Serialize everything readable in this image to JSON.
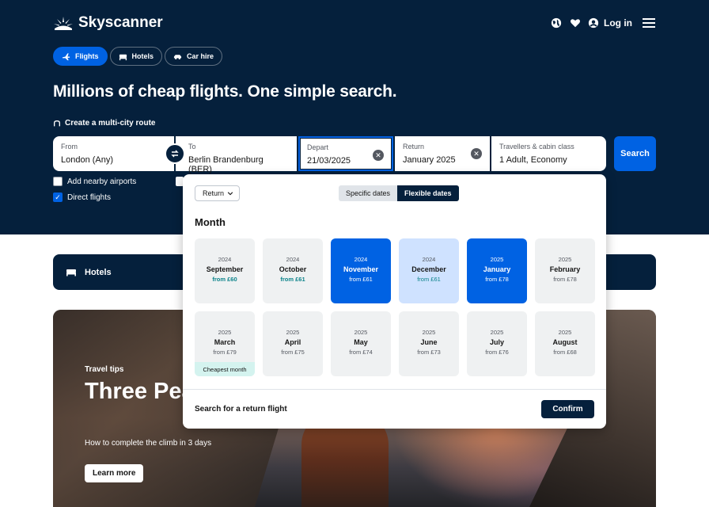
{
  "header": {
    "brand": "Skyscanner",
    "login_label": "Log in"
  },
  "nav_tabs": [
    {
      "label": "Flights",
      "icon": "plane-icon",
      "active": true
    },
    {
      "label": "Hotels",
      "icon": "bed-icon",
      "active": false
    },
    {
      "label": "Car hire",
      "icon": "car-icon",
      "active": false
    }
  ],
  "headline": "Millions of cheap flights. One simple search.",
  "multicity_label": "Create a multi-city route",
  "search": {
    "from": {
      "label": "From",
      "value": "London (Any)"
    },
    "to": {
      "label": "To",
      "value": "Berlin Brandenburg (BER)"
    },
    "depart": {
      "label": "Depart",
      "value": "21/03/2025"
    },
    "return": {
      "label": "Return",
      "value": "January 2025"
    },
    "travellers": {
      "label": "Travellers & cabin class",
      "value": "1 Adult, Economy"
    },
    "button_label": "Search"
  },
  "options": {
    "nearby": {
      "label": "Add nearby airports",
      "checked": false
    },
    "direct": {
      "label": "Direct flights",
      "checked": true
    }
  },
  "hotels_bar": {
    "label": "Hotels"
  },
  "promo": {
    "kicker": "Travel tips",
    "title": "Three Peaks Challenge",
    "subtitle": "How to complete the climb in 3 days",
    "button_label": "Learn more"
  },
  "date_picker": {
    "trip_type": "Return",
    "date_modes": [
      "Specific dates",
      "Flexible dates"
    ],
    "active_mode": "Flexible dates",
    "heading": "Month",
    "months": [
      {
        "year": "2024",
        "month": "September",
        "price": "from £60",
        "state": "cheap"
      },
      {
        "year": "2024",
        "month": "October",
        "price": "from £61",
        "state": "cheap"
      },
      {
        "year": "2024",
        "month": "November",
        "price": "from £61",
        "state": "selected"
      },
      {
        "year": "2024",
        "month": "December",
        "price": "from £61",
        "state": "in-range"
      },
      {
        "year": "2025",
        "month": "January",
        "price": "from £78",
        "state": "selected"
      },
      {
        "year": "2025",
        "month": "February",
        "price": "from £78",
        "state": "normal"
      },
      {
        "year": "2025",
        "month": "March",
        "price": "from £79",
        "state": "normal",
        "badge": "Cheapest month"
      },
      {
        "year": "2025",
        "month": "April",
        "price": "from £75",
        "state": "normal"
      },
      {
        "year": "2025",
        "month": "May",
        "price": "from £74",
        "state": "normal"
      },
      {
        "year": "2025",
        "month": "June",
        "price": "from £73",
        "state": "normal"
      },
      {
        "year": "2025",
        "month": "July",
        "price": "from £76",
        "state": "normal"
      },
      {
        "year": "2025",
        "month": "August",
        "price": "from £68",
        "state": "normal"
      }
    ],
    "footer_text": "Search for a return flight",
    "confirm_label": "Confirm"
  },
  "colors": {
    "navy": "#05203c",
    "blue": "#0062e3",
    "light_blue": "#cfe2ff",
    "teal": "#0c838a",
    "card_grey": "#eff1f2"
  }
}
